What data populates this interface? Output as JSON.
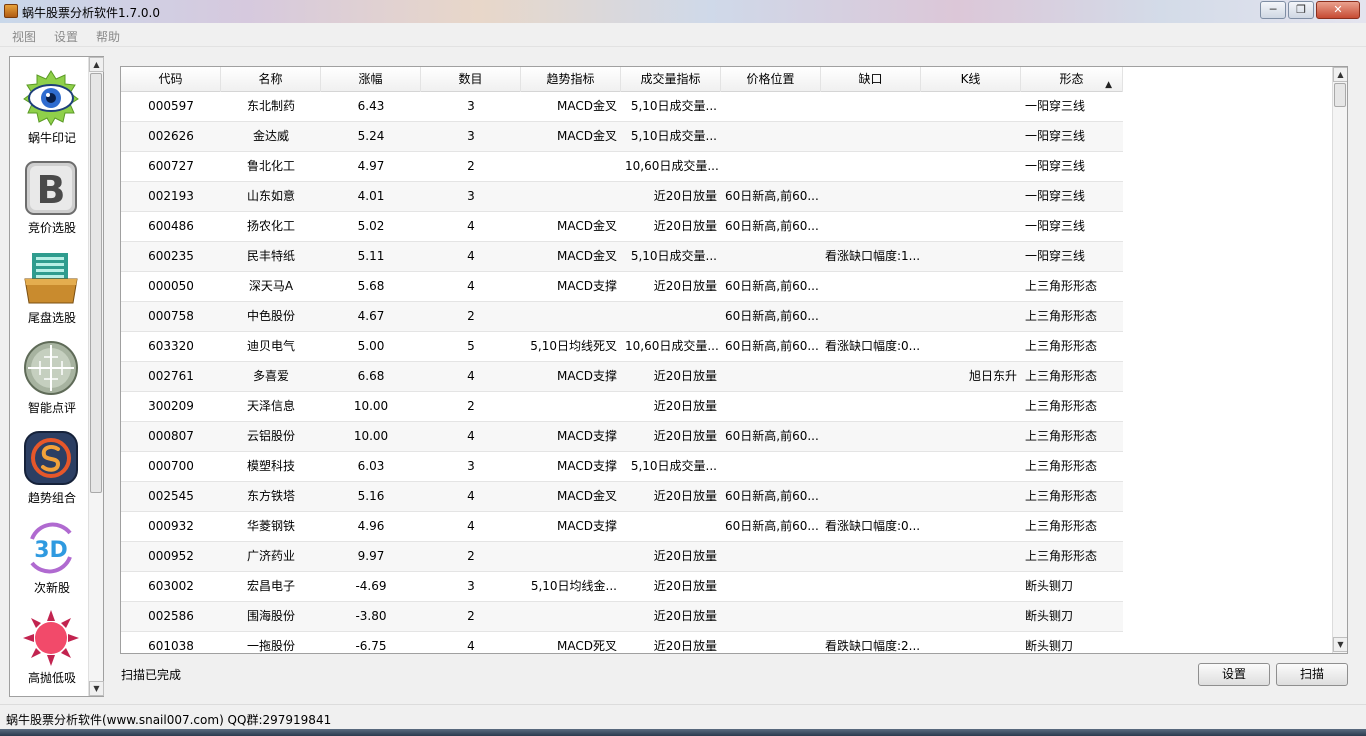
{
  "window": {
    "title": "蜗牛股票分析软件1.7.0.0",
    "min": "─",
    "max": "❐",
    "close": "✕"
  },
  "menu": [
    "视图",
    "设置",
    "帮助"
  ],
  "tools": [
    {
      "label": "蜗牛印记",
      "icon": "eye-icon"
    },
    {
      "label": "竞价选股",
      "icon": "letter-b-icon"
    },
    {
      "label": "尾盘选股",
      "icon": "folder-icon"
    },
    {
      "label": "智能点评",
      "icon": "crosshair-icon"
    },
    {
      "label": "趋势组合",
      "icon": "s-logo-icon"
    },
    {
      "label": "次新股",
      "icon": "3d-icon",
      "icon_text": "3D"
    },
    {
      "label": "高抛低吸",
      "icon": "sun-icon"
    }
  ],
  "table": {
    "columns": [
      "代码",
      "名称",
      "涨幅",
      "数目",
      "趋势指标",
      "成交量指标",
      "价格位置",
      "缺口",
      "K线",
      "形态"
    ],
    "sort_glyph": "▲",
    "rows": [
      [
        "000597",
        "东北制药",
        "6.43",
        "3",
        "MACD金叉",
        "5,10日成交量...",
        "",
        "",
        "",
        "一阳穿三线"
      ],
      [
        "002626",
        "金达威",
        "5.24",
        "3",
        "MACD金叉",
        "5,10日成交量...",
        "",
        "",
        "",
        "一阳穿三线"
      ],
      [
        "600727",
        "鲁北化工",
        "4.97",
        "2",
        "",
        "10,60日成交量...",
        "",
        "",
        "",
        "一阳穿三线"
      ],
      [
        "002193",
        "山东如意",
        "4.01",
        "3",
        "",
        "近20日放量",
        "60日新高,前60...",
        "",
        "",
        "一阳穿三线"
      ],
      [
        "600486",
        "扬农化工",
        "5.02",
        "4",
        "MACD金叉",
        "近20日放量",
        "60日新高,前60...",
        "",
        "",
        "一阳穿三线"
      ],
      [
        "600235",
        "民丰特纸",
        "5.11",
        "4",
        "MACD金叉",
        "5,10日成交量...",
        "",
        "看涨缺口幅度:1...",
        "",
        "一阳穿三线"
      ],
      [
        "000050",
        "深天马A",
        "5.68",
        "4",
        "MACD支撑",
        "近20日放量",
        "60日新高,前60...",
        "",
        "",
        "上三角形形态"
      ],
      [
        "000758",
        "中色股份",
        "4.67",
        "2",
        "",
        "",
        "60日新高,前60...",
        "",
        "",
        "上三角形形态"
      ],
      [
        "603320",
        "迪贝电气",
        "5.00",
        "5",
        "5,10日均线死叉",
        "10,60日成交量...",
        "60日新高,前60...",
        "看涨缺口幅度:0...",
        "",
        "上三角形形态"
      ],
      [
        "002761",
        "多喜爱",
        "6.68",
        "4",
        "MACD支撑",
        "近20日放量",
        "",
        "",
        "旭日东升",
        "上三角形形态"
      ],
      [
        "300209",
        "天泽信息",
        "10.00",
        "2",
        "",
        "近20日放量",
        "",
        "",
        "",
        "上三角形形态"
      ],
      [
        "000807",
        "云铝股份",
        "10.00",
        "4",
        "MACD支撑",
        "近20日放量",
        "60日新高,前60...",
        "",
        "",
        "上三角形形态"
      ],
      [
        "000700",
        "模塑科技",
        "6.03",
        "3",
        "MACD支撑",
        "5,10日成交量...",
        "",
        "",
        "",
        "上三角形形态"
      ],
      [
        "002545",
        "东方铁塔",
        "5.16",
        "4",
        "MACD金叉",
        "近20日放量",
        "60日新高,前60...",
        "",
        "",
        "上三角形形态"
      ],
      [
        "000932",
        "华菱钢铁",
        "4.96",
        "4",
        "MACD支撑",
        "",
        "60日新高,前60...",
        "看涨缺口幅度:0...",
        "",
        "上三角形形态"
      ],
      [
        "000952",
        "广济药业",
        "9.97",
        "2",
        "",
        "近20日放量",
        "",
        "",
        "",
        "上三角形形态"
      ],
      [
        "603002",
        "宏昌电子",
        "-4.69",
        "3",
        "5,10日均线金...",
        "近20日放量",
        "",
        "",
        "",
        "断头铡刀"
      ],
      [
        "002586",
        "围海股份",
        "-3.80",
        "2",
        "",
        "近20日放量",
        "",
        "",
        "",
        "断头铡刀"
      ],
      [
        "601038",
        "一拖股份",
        "-6.75",
        "4",
        "MACD死叉",
        "近20日放量",
        "",
        "看跌缺口幅度:2...",
        "",
        "断头铡刀"
      ]
    ]
  },
  "status": "扫描已完成",
  "buttons": {
    "settings": "设置",
    "scan": "扫描"
  },
  "footer": "蜗牛股票分析软件(www.snail007.com) QQ群:297919841",
  "scroll_glyphs": {
    "up": "▲",
    "down": "▼"
  }
}
